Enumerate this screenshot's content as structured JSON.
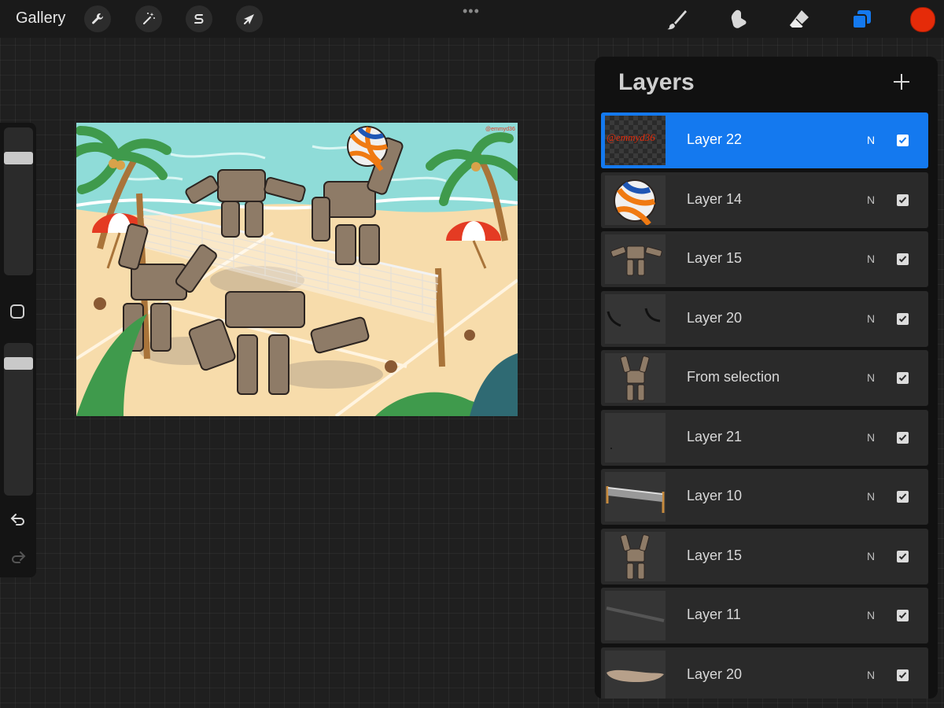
{
  "topbar": {
    "gallery_label": "Gallery",
    "actions_icon": "wrench-icon",
    "adjustments_icon": "magic-wand-icon",
    "selection_icon": "selection-s-icon",
    "transform_icon": "arrow-cursor-icon",
    "more_label": "•••",
    "brush_icon": "brush-icon",
    "smudge_icon": "smudge-icon",
    "eraser_icon": "eraser-icon",
    "layers_icon": "layers-icon",
    "active_color": "#e52b09"
  },
  "sidebar": {
    "brush_size": 0.82,
    "opacity": 0.9,
    "undo_icon": "undo-icon",
    "redo_icon": "redo-icon",
    "modify_icon": "square-icon"
  },
  "canvas": {
    "watermark": "@emmyd36"
  },
  "layers": {
    "title": "Layers",
    "add_icon": "plus-icon",
    "items": [
      {
        "name": "Layer 22",
        "blend": "N",
        "visible": true,
        "selected": true,
        "thumb": "watermark",
        "thumb_text": "@emmyd36"
      },
      {
        "name": "Layer 14",
        "blend": "N",
        "visible": true,
        "selected": false,
        "thumb": "ball"
      },
      {
        "name": "Layer 15",
        "blend": "N",
        "visible": true,
        "selected": false,
        "thumb": "golem"
      },
      {
        "name": "Layer 20",
        "blend": "N",
        "visible": true,
        "selected": false,
        "thumb": "strokes"
      },
      {
        "name": "From selection",
        "blend": "N",
        "visible": true,
        "selected": false,
        "thumb": "golem-up"
      },
      {
        "name": "Layer 21",
        "blend": "N",
        "visible": true,
        "selected": false,
        "thumb": "blank"
      },
      {
        "name": "Layer 10",
        "blend": "N",
        "visible": true,
        "selected": false,
        "thumb": "net"
      },
      {
        "name": "Layer 15",
        "blend": "N",
        "visible": true,
        "selected": false,
        "thumb": "golem-up"
      },
      {
        "name": "Layer 11",
        "blend": "N",
        "visible": true,
        "selected": false,
        "thumb": "line"
      },
      {
        "name": "Layer 20",
        "blend": "N",
        "visible": true,
        "selected": false,
        "thumb": "shadow"
      }
    ]
  }
}
